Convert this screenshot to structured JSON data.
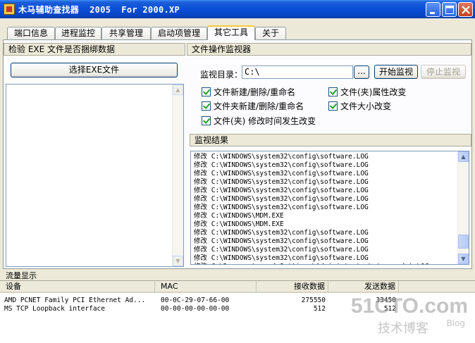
{
  "window": {
    "title": "木马辅助查找器  2005  For 2000.XP"
  },
  "tabs": [
    {
      "label": "端口信息"
    },
    {
      "label": "进程监控"
    },
    {
      "label": "共享管理"
    },
    {
      "label": "启动项管理"
    },
    {
      "label": "其它工具",
      "active": true
    },
    {
      "label": "关于"
    }
  ],
  "left_panel": {
    "header": "检验 EXE 文件是否捆绑数据",
    "select_button": "选择EXE文件"
  },
  "right_panel": {
    "header": "文件操作监视器",
    "dir_label": "监视目录：",
    "dir_value": "C:\\",
    "browse_button": "...",
    "start_button": "开始监视",
    "stop_button": "停止监视",
    "options": [
      {
        "label": "文件新建/删除/重命名",
        "checked": true
      },
      {
        "label": "文件(夹)属性改变",
        "checked": true
      },
      {
        "label": "文件夹新建/删除/重命名",
        "checked": true
      },
      {
        "label": "文件大小改变",
        "checked": true
      },
      {
        "label": "文件(夹) 修改时间发生改变",
        "checked": true
      }
    ],
    "results_header": "监视结果",
    "results": [
      "修改 C:\\WINDOWS\\system32\\config\\software.LOG",
      "修改 C:\\WINDOWS\\system32\\config\\software.LOG",
      "修改 C:\\WINDOWS\\system32\\config\\software.LOG",
      "修改 C:\\WINDOWS\\system32\\config\\software.LOG",
      "修改 C:\\WINDOWS\\system32\\config\\software.LOG",
      "修改 C:\\WINDOWS\\system32\\config\\software.LOG",
      "修改 C:\\WINDOWS\\system32\\config\\software.LOG",
      "修改 C:\\WINDOWS\\MDM.EXE",
      "修改 C:\\WINDOWS\\MDM.EXE",
      "修改 C:\\WINDOWS\\system32\\config\\software.LOG",
      "修改 C:\\WINDOWS\\system32\\config\\software.LOG",
      "修改 C:\\WINDOWS\\system32\\config\\software.LOG",
      "修改 C:\\WINDOWS\\system32\\config\\software.LOG",
      "修改 C:\\Documents and Settings\\Administrator\\ntuser.dat.LOG"
    ]
  },
  "traffic": {
    "title": "流量显示",
    "columns": [
      "设备",
      "MAC",
      "接收数据",
      "发送数据"
    ],
    "rows": [
      {
        "device": "AMD PCNET Family PCI Ethernet Ad...",
        "mac": "00-0C-29-07-66-00",
        "recv": "275550",
        "sent": "33450"
      },
      {
        "device": "MS TCP Loopback interface",
        "mac": "00-00-00-00-00-00",
        "recv": "512",
        "sent": "512"
      }
    ]
  },
  "watermark": {
    "line1": "51CTO.com",
    "line2": "技术博客",
    "line3": "Blog"
  },
  "colors": {
    "titlebar": "#0A4ED6",
    "window_bg": "#ECE9D8",
    "active_tab_highlight": "#FFC83C",
    "checkmark": "#21A121"
  }
}
